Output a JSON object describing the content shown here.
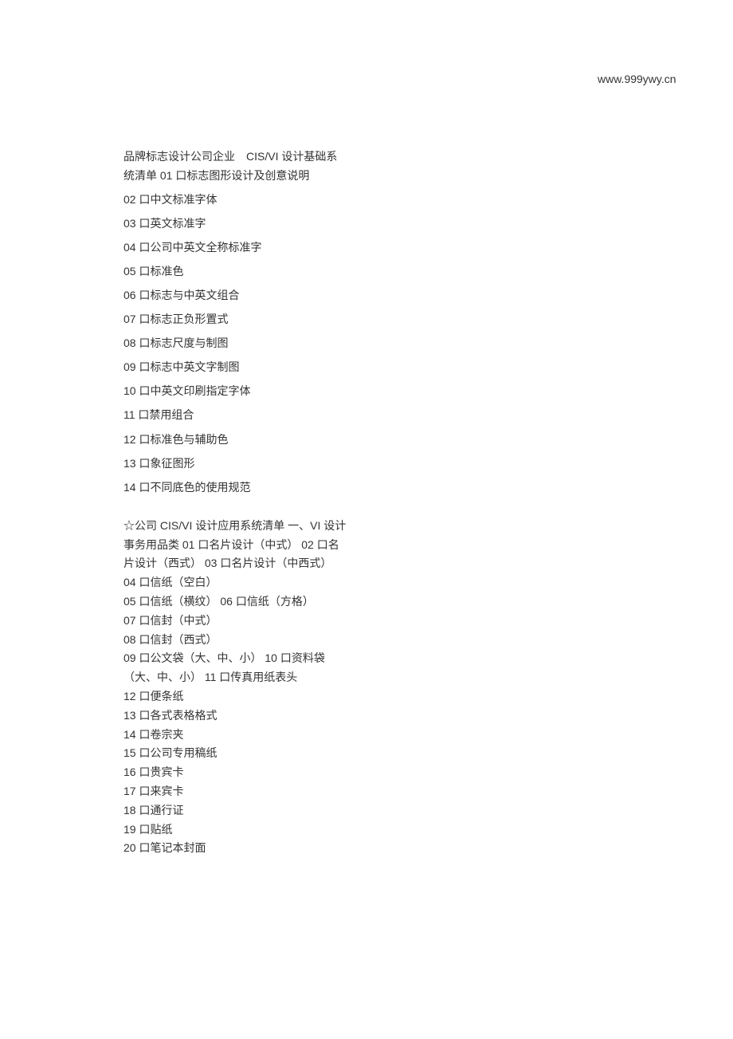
{
  "header": {
    "url": "www.999ywy.cn"
  },
  "section1": {
    "intro": "品牌标志设计公司企业　CIS/VI 设计基础系统清单  01 口标志图形设计及创意说明",
    "items": [
      "02 口中文标准字体",
      "03 口英文标准字",
      "04 口公司中英文全称标准字",
      "05 口标准色",
      "06 口标志与中英文组合",
      "07 口标志正负形置式",
      "08 口标志尺度与制图",
      "09 口标志中英文字制图",
      "10 口中英文印刷指定字体",
      "11 口禁用组合",
      "12 口标准色与辅助色",
      "13 口象征图形",
      "14 口不同底色的使用规范"
    ]
  },
  "section2": {
    "intro": "☆公司 CIS/VI 设计应用系统清单  一、VI 设计事务用品类  01 口名片设计（中式） 02 口名片设计（西式） 03 口名片设计（中西式） 04 口信纸（空白）",
    "items": [
      "05 口信纸（横纹） 06 口信纸（方格）",
      "07 口信封（中式）",
      "08 口信封（西式）",
      "09 口公文袋（大、中、小） 10 口资料袋（大、中、小） 11 口传真用纸表头",
      "12 口便条纸",
      "13 口各式表格格式",
      "14 口卷宗夹",
      "15 口公司专用稿纸",
      "16 口贵宾卡",
      "17 口来宾卡",
      "18 口通行证",
      "19 口贴纸",
      "20 口笔记本封面"
    ]
  }
}
